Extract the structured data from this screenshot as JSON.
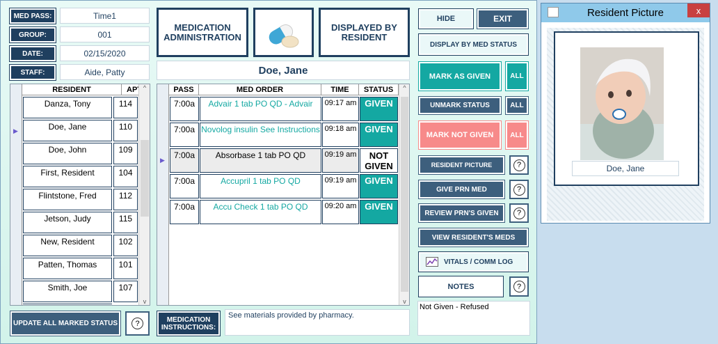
{
  "header": {
    "med_pass_label": "MED PASS:",
    "med_pass_value": "Time1",
    "group_label": "GROUP:",
    "group_value": "001",
    "date_label": "DATE:",
    "date_value": "02/15/2020",
    "staff_label": "STAFF:",
    "staff_value": "Aide, Patty"
  },
  "title_box": "MEDICATION ADMINISTRATION",
  "display_box": "DISPLAYED BY RESIDENT",
  "selected_resident": "Doe, Jane",
  "resident_table": {
    "headers": [
      "RESIDENT",
      "APT"
    ],
    "rows": [
      {
        "name": "Danza, Tony",
        "apt": "114"
      },
      {
        "name": "Doe, Jane",
        "apt": "110"
      },
      {
        "name": "Doe, John",
        "apt": "109"
      },
      {
        "name": "First, Resident",
        "apt": "104"
      },
      {
        "name": "Flintstone, Fred",
        "apt": "112"
      },
      {
        "name": "Jetson, Judy",
        "apt": "115"
      },
      {
        "name": "New, Resident",
        "apt": "102"
      },
      {
        "name": "Patten, Thomas",
        "apt": "101"
      },
      {
        "name": "Smith, Joe",
        "apt": "107"
      }
    ]
  },
  "med_table": {
    "headers": [
      "PASS",
      "MED ORDER",
      "TIME",
      "STATUS"
    ],
    "rows": [
      {
        "pass": "7:00a",
        "order": "Advair 1 tab PO QD - Advair",
        "time": "09:17 am",
        "status": "GIVEN"
      },
      {
        "pass": "7:00a",
        "order": "Novolog insulin See Instructions",
        "time": "09:18 am",
        "status": "GIVEN"
      },
      {
        "pass": "7:00a",
        "order": "Absorbase 1 tab PO QD",
        "time": "09:19 am",
        "status": "NOT GIVEN"
      },
      {
        "pass": "7:00a",
        "order": "Accupril 1 tab PO QD",
        "time": "09:19 am",
        "status": "GIVEN"
      },
      {
        "pass": "7:00a",
        "order": "Accu Check 1 tab PO QD",
        "time": "09:20 am",
        "status": "GIVEN"
      }
    ]
  },
  "buttons": {
    "hide": "HIDE",
    "exit": "EXIT",
    "display_by_med_status": "DISPLAY BY MED STATUS",
    "mark_as_given": "MARK AS GIVEN",
    "all": "ALL",
    "unmark_status": "UNMARK STATUS",
    "mark_not_given": "MARK NOT GIVEN",
    "resident_picture": "RESIDENT PICTURE",
    "give_prn_med": "GIVE PRN MED",
    "review_prns_given": "REVIEW PRN'S GIVEN",
    "view_residents_meds": "VIEW RESIDENT'S MEDS",
    "vitals_comm_log": "VITALS / COMM  LOG",
    "notes": "NOTES",
    "update_all": "UPDATE ALL MARKED STATUS",
    "help": "?"
  },
  "instructions": {
    "label": "MEDICATION INSTRUCTIONS:",
    "text": "See materials provided by pharmacy."
  },
  "notes_text": "Not Given - Refused",
  "picture_window": {
    "title": "Resident Picture",
    "close": "x",
    "caption": "Doe, Jane"
  },
  "colors": {
    "navy": "#1f3f5f",
    "teal": "#14a8a2",
    "pink": "#f78a8a"
  }
}
